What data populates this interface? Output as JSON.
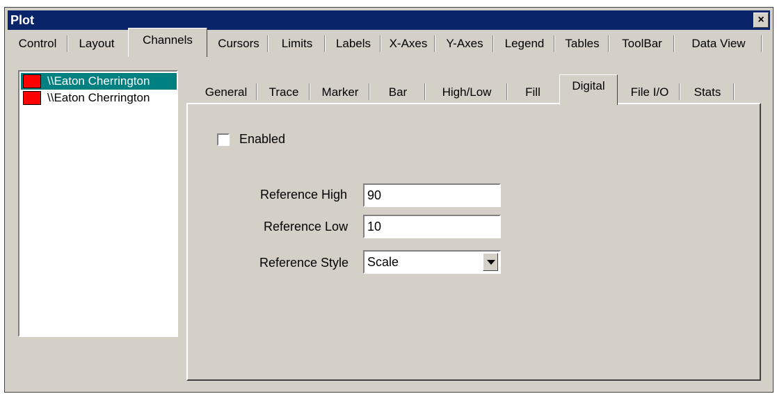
{
  "window": {
    "title": "Plot",
    "close_label": "×"
  },
  "top_tabs": [
    "Control",
    "Layout",
    "Channels",
    "Cursors",
    "Limits",
    "Labels",
    "X-Axes",
    "Y-Axes",
    "Legend",
    "Tables",
    "ToolBar",
    "Data View"
  ],
  "active_top_tab": "Channels",
  "channels": [
    {
      "label": "\\\\Eaton Cherrington",
      "color": "#ff0000"
    },
    {
      "label": "\\\\Eaton Cherrington",
      "color": "#ff0000"
    }
  ],
  "sub_tabs": [
    "General",
    "Trace",
    "Marker",
    "Bar",
    "High/Low",
    "Fill",
    "Digital",
    "File I/O",
    "Stats"
  ],
  "active_sub_tab": "Digital",
  "digital": {
    "enabled_label": "Enabled",
    "enabled": false,
    "reference_high_label": "Reference High",
    "reference_high_value": "90",
    "reference_low_label": "Reference Low",
    "reference_low_value": "10",
    "reference_style_label": "Reference Style",
    "reference_style_value": "Scale"
  }
}
